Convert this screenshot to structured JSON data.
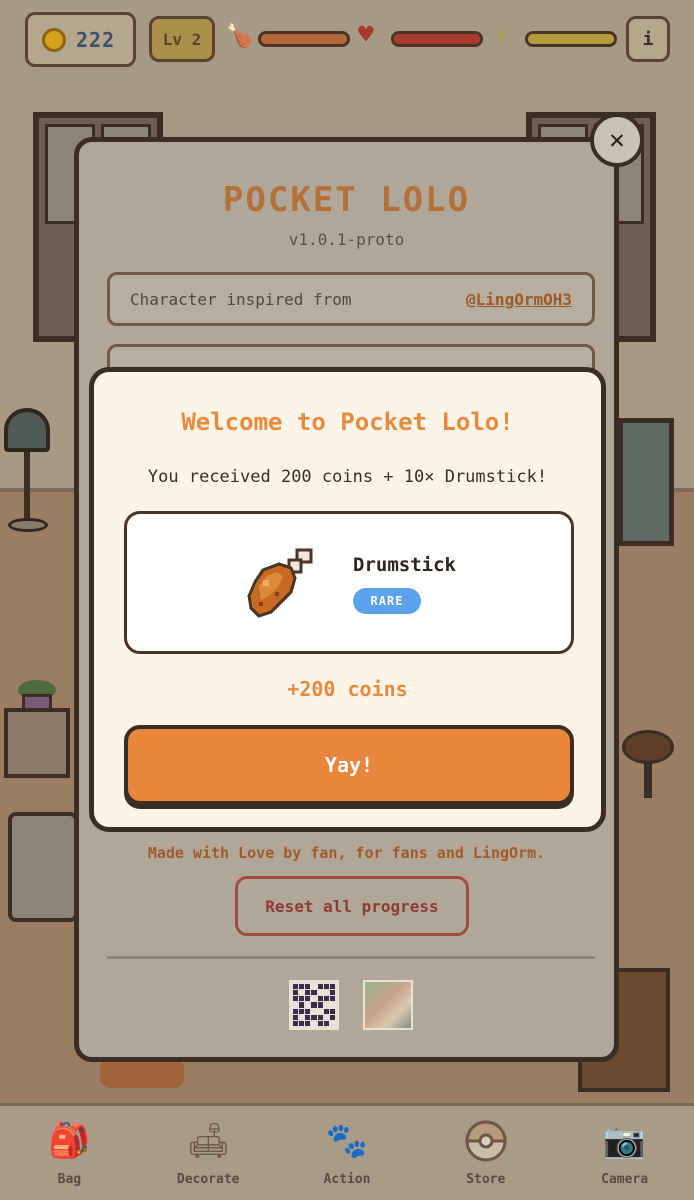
{
  "hud": {
    "coins": "222",
    "level": "Lv 2",
    "stats": [
      {
        "name": "hunger",
        "icon": "drumstick-icon",
        "fill_fraction": 1.0,
        "color": "#b0683c"
      },
      {
        "name": "health",
        "icon": "heart-icon",
        "fill_fraction": 1.0,
        "color": "#a83a32"
      },
      {
        "name": "energy",
        "icon": "lightning-icon",
        "fill_fraction": 1.0,
        "color": "#b49b3c"
      }
    ],
    "info_label": "i"
  },
  "about": {
    "title": "POCKET LOLO",
    "version": "v1.0.1-proto",
    "credit_label": "Character inspired from",
    "credit_link": "@LingOrmOH3",
    "made_with": "Made with Love by fan, for fans and LingOrm.",
    "reset_label": "Reset all progress",
    "close_label": "✕"
  },
  "welcome": {
    "title": "Welcome to Pocket Lolo!",
    "subtitle": "You received 200 coins + 10× Drumstick!",
    "item_name": "Drumstick",
    "rarity": "RARE",
    "coins_bonus": "+200 coins",
    "confirm_label": "Yay!"
  },
  "nav": {
    "items": [
      {
        "label": "Bag",
        "icon": "bag-icon"
      },
      {
        "label": "Decorate",
        "icon": "armchair-icon"
      },
      {
        "label": "Action",
        "icon": "paw-icon"
      },
      {
        "label": "Store",
        "icon": "pokeball-icon"
      },
      {
        "label": "Camera",
        "icon": "camera-icon"
      }
    ]
  },
  "colors": {
    "accent": "#e8873c",
    "rare_badge": "#5aa3ec",
    "outline": "#3a2d24"
  }
}
